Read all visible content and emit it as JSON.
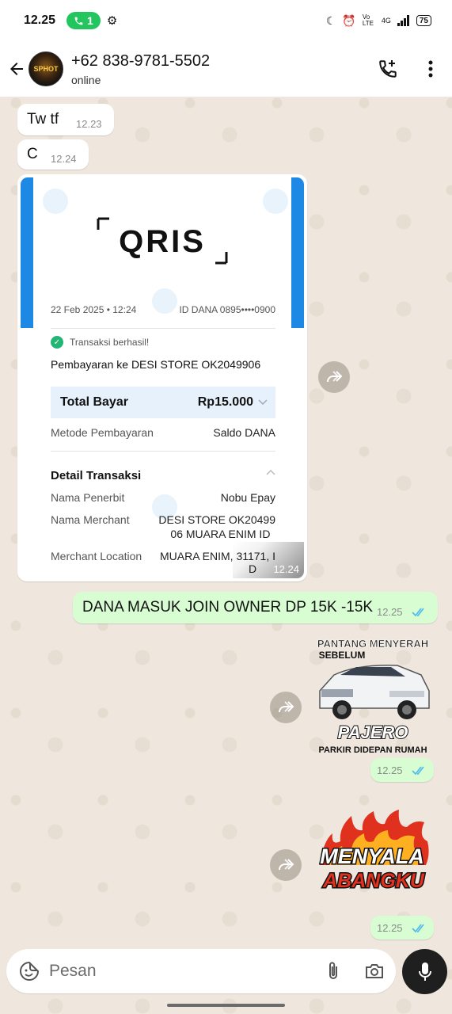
{
  "status_bar": {
    "time": "12.25",
    "call_count": "1",
    "network_label": "Vo LTE",
    "signal_label": "4G",
    "battery": "75"
  },
  "header": {
    "contact_name": "+62 838-9781-5502",
    "status": "online"
  },
  "messages": [
    {
      "dir": "in",
      "text": "Tw tf",
      "time": "12.23"
    },
    {
      "dir": "in",
      "text": "C",
      "time": "12.24"
    },
    {
      "dir": "in",
      "type": "image",
      "time": "12.24"
    },
    {
      "dir": "out",
      "text": "DANA MASUK JOIN OWNER DP 15K -15K",
      "time": "12.25"
    },
    {
      "dir": "out",
      "type": "sticker",
      "time": "12.25"
    },
    {
      "dir": "out",
      "type": "sticker",
      "time": "12.25"
    }
  ],
  "receipt": {
    "logo": "QRIS",
    "date": "22 Feb 2025 • 12:24",
    "dana_id": "ID DANA 0895••••0900",
    "success": "Transaksi berhasil!",
    "payment_to": "Pembayaran ke DESI STORE OK2049906",
    "total_label": "Total Bayar",
    "total_value": "Rp15.000",
    "method_label": "Metode Pembayaran",
    "method_value": "Saldo DANA",
    "details_title": "Detail Transaksi",
    "issuer_label": "Nama Penerbit",
    "issuer_value": "Nobu Epay",
    "merchant_label": "Nama Merchant",
    "merchant_value_1": "DESI STORE OK20499",
    "merchant_value_2": "06 MUARA ENIM ID",
    "location_label": "Merchant Location",
    "location_value": "MUARA ENIM, 31171, I",
    "location_value_2": "D"
  },
  "sticker_pajero": {
    "top_line_1": "PANTANG MENYERAH",
    "top_line_2": "SEBELUM",
    "brand": "PAJERO",
    "bottom": "PARKIR DIDEPAN RUMAH"
  },
  "sticker_menyala": {
    "line_1": "MENYALA",
    "line_2": "ABANGKU"
  },
  "avatar_text": "SPHOT",
  "input": {
    "placeholder": "Pesan"
  },
  "colors": {
    "bubble_out": "#d9fdd3",
    "tick_blue": "#53bdeb",
    "dana_blue": "#1e88e5"
  }
}
